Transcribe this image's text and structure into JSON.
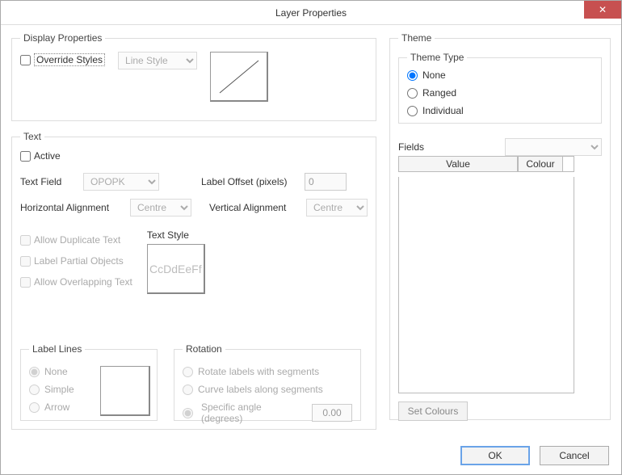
{
  "window": {
    "title": "Layer Properties",
    "close_icon": "✕"
  },
  "display": {
    "legend": "Display Properties",
    "override_styles_label": "Override Styles",
    "line_style_select": "Line Style"
  },
  "text": {
    "legend": "Text",
    "active_label": "Active",
    "text_field_label": "Text Field",
    "text_field_value": "OPOPK",
    "label_offset_label": "Label Offset (pixels)",
    "label_offset_value": "0",
    "h_align_label": "Horizontal Alignment",
    "h_align_value": "Centre",
    "v_align_label": "Vertical Alignment",
    "v_align_value": "Centre",
    "allow_duplicate_label": "Allow Duplicate Text",
    "label_partial_label": "Label Partial Objects",
    "allow_overlap_label": "Allow Overlapping Text",
    "text_style_label": "Text Style",
    "text_style_preview": "CcDdEeFf"
  },
  "label_lines": {
    "legend": "Label Lines",
    "none": "None",
    "simple": "Simple",
    "arrow": "Arrow"
  },
  "rotation": {
    "legend": "Rotation",
    "rotate_segments": "Rotate labels with segments",
    "curve_segments": "Curve labels along segments",
    "specific_angle": "Specific angle (degrees)",
    "angle_value": "0.00"
  },
  "theme": {
    "legend": "Theme",
    "type_legend": "Theme Type",
    "none": "None",
    "ranged": "Ranged",
    "individual": "Individual",
    "fields_label": "Fields",
    "table_value": "Value",
    "table_colour": "Colour",
    "set_colours_label": "Set Colours"
  },
  "footer": {
    "ok": "OK",
    "cancel": "Cancel"
  }
}
